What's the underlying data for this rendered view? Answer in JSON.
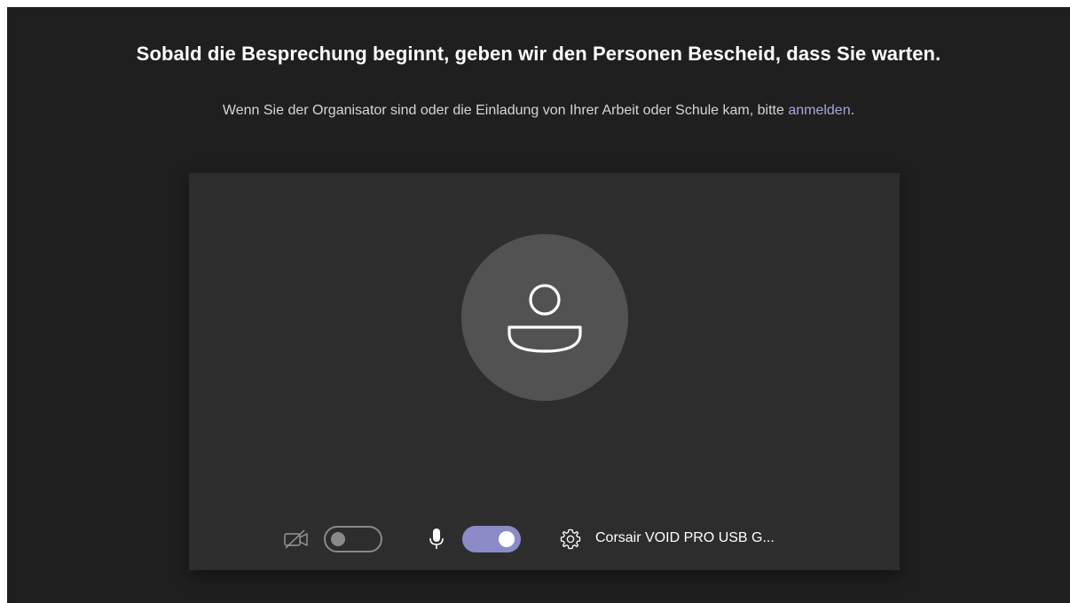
{
  "header": {
    "title": "Sobald die Besprechung beginnt, geben wir den Personen Bescheid, dass Sie warten.",
    "subtitle_prefix": "Wenn Sie der Organisator sind oder die Einladung von Ihrer Arbeit oder Schule kam, bitte ",
    "signin_link": "anmelden",
    "subtitle_suffix": "."
  },
  "preview": {
    "avatar_icon": "person-icon"
  },
  "controls": {
    "camera": {
      "icon": "camera-off-icon",
      "enabled": false
    },
    "microphone": {
      "icon": "microphone-icon",
      "enabled": true
    },
    "device_settings": {
      "icon": "gear-icon",
      "label": "Corsair VOID PRO USB G..."
    }
  },
  "colors": {
    "background": "#1f1f1f",
    "preview_background": "#2d2d2d",
    "avatar_background": "#525252",
    "accent": "#8b8cc7",
    "link": "#a6a7dc"
  }
}
